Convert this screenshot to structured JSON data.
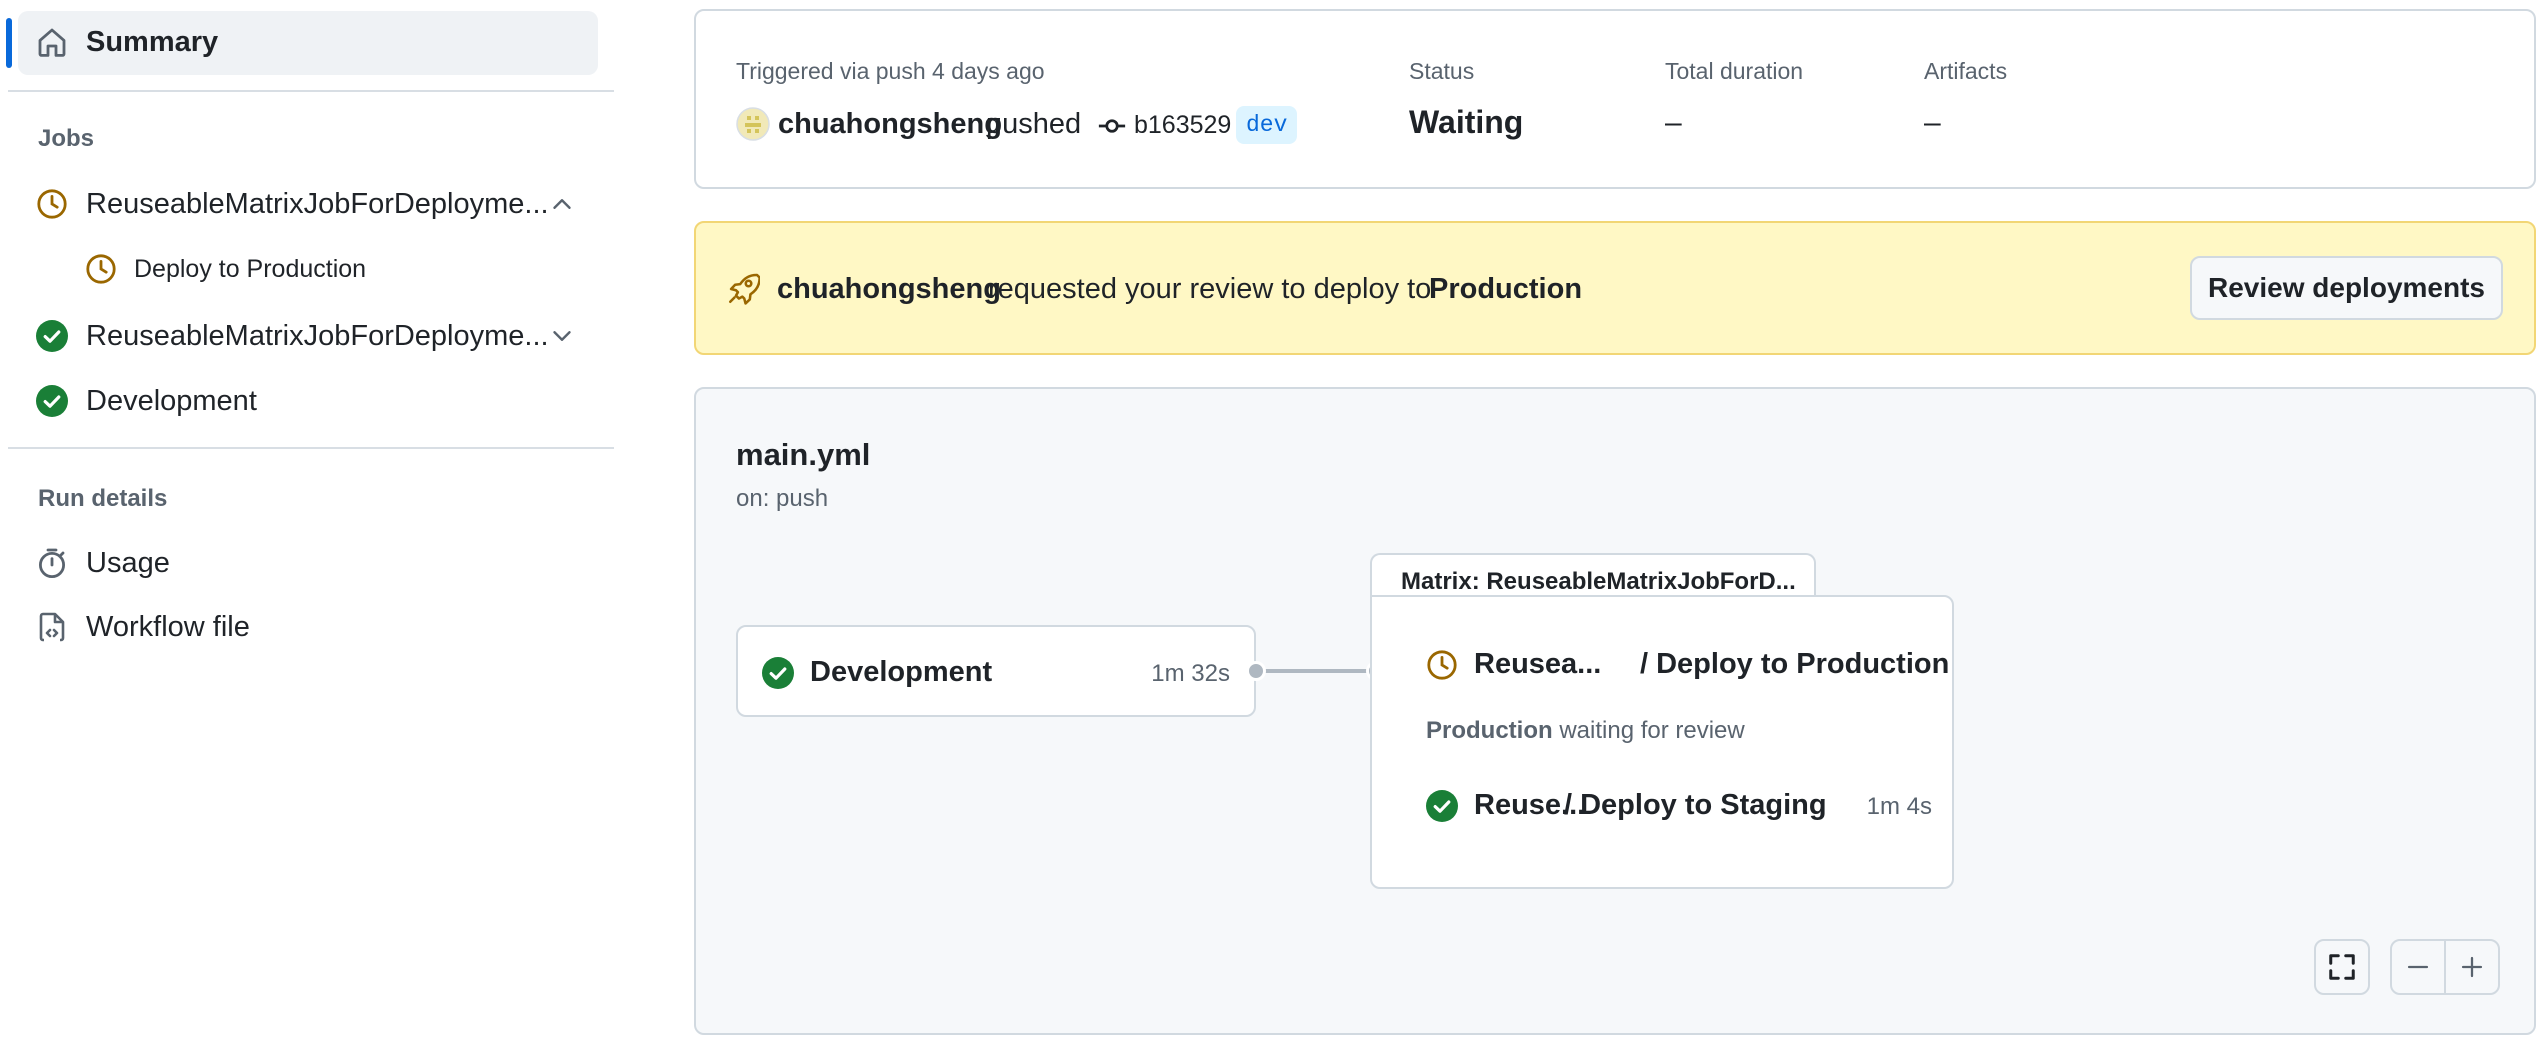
{
  "sidebar": {
    "summary_label": "Summary",
    "jobs_heading": "Jobs",
    "jobs": [
      {
        "label": "ReuseableMatrixJobForDeployme...",
        "status": "waiting",
        "expanded": true,
        "children": [
          {
            "label": "Deploy to Production",
            "status": "waiting"
          }
        ]
      },
      {
        "label": "ReuseableMatrixJobForDeployme...",
        "status": "success",
        "expanded": false
      },
      {
        "label": "Development",
        "status": "success"
      }
    ],
    "run_details_heading": "Run details",
    "usage_label": "Usage",
    "workflow_file_label": "Workflow file"
  },
  "summary": {
    "trigger_text": "Triggered via push 4 days ago",
    "actor": "chuahongsheng",
    "action": "pushed",
    "commit_sha": "b163529",
    "branch": "dev",
    "status_label": "Status",
    "status_value": "Waiting",
    "duration_label": "Total duration",
    "duration_value": "–",
    "artifacts_label": "Artifacts",
    "artifacts_value": "–"
  },
  "review_banner": {
    "actor": "chuahongsheng",
    "message": "requested your review to deploy to",
    "environment": "Production",
    "button_label": "Review deployments"
  },
  "workflow": {
    "file_name": "main.yml",
    "trigger": "on: push",
    "development_job": {
      "label": "Development",
      "duration": "1m 32s",
      "status": "success"
    },
    "matrix": {
      "title": "Matrix: ReuseableMatrixJobForD...",
      "production_job": {
        "prefix": "Reusea...",
        "label": "/ Deploy to Production",
        "status": "waiting"
      },
      "production_note": {
        "environment": "Production",
        "text": "waiting for review"
      },
      "staging_job": {
        "prefix": "Reuse...",
        "label": "/ Deploy to Staging",
        "duration": "1m 4s",
        "status": "success"
      }
    }
  },
  "colors": {
    "success": "#1a7f37",
    "waiting": "#9a6700",
    "accent": "#0969da",
    "banner_bg": "#fff8c5",
    "branch_bg": "#ddf4ff",
    "branch_text": "#0969da"
  },
  "icons": {
    "summary": "home-icon",
    "waiting": "clock-icon",
    "success": "check-circle-icon",
    "usage": "stopwatch-icon",
    "workflow_file": "file-code-icon",
    "commit": "git-commit-icon",
    "banner": "rocket-icon",
    "fullscreen": "fullscreen-icon",
    "zoom_out": "minus-icon",
    "zoom_in": "plus-icon"
  }
}
